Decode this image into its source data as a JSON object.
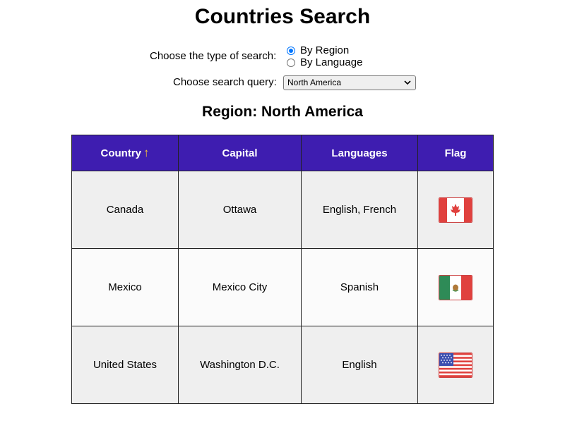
{
  "page": {
    "title": "Countries Search"
  },
  "search": {
    "type_label": "Choose the type of search:",
    "options": [
      {
        "label": "By Region",
        "checked": true
      },
      {
        "label": "By Language",
        "checked": false
      }
    ],
    "query_label": "Choose search query:",
    "query_value": "North America"
  },
  "results": {
    "heading": "Region: North America",
    "columns": [
      "Country",
      "Capital",
      "Languages",
      "Flag"
    ],
    "sort_indicator": "↑",
    "rows": [
      {
        "country": "Canada",
        "capital": "Ottawa",
        "languages": "English, French",
        "flag": "canada-flag-icon"
      },
      {
        "country": "Mexico",
        "capital": "Mexico City",
        "languages": "Spanish",
        "flag": "mexico-flag-icon"
      },
      {
        "country": "United States",
        "capital": "Washington D.C.",
        "languages": "English",
        "flag": "usa-flag-icon"
      }
    ]
  },
  "colors": {
    "header_bg": "#3e1db0",
    "sort_arrow": "#f5c238",
    "radio_accent": "#0075ff"
  }
}
